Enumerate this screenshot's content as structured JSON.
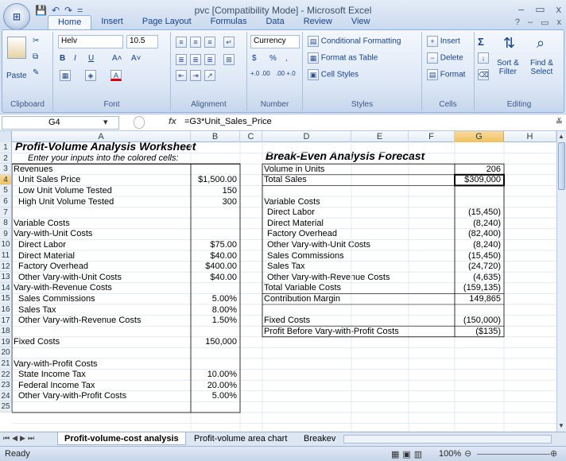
{
  "window": {
    "title": "pvc  [Compatibility Mode] - Microsoft Excel",
    "min": "–",
    "max": "▭",
    "close": "x"
  },
  "qat": {
    "save": "💾",
    "undo": "↶",
    "redo": "↷",
    "more": "="
  },
  "office_button": "⊞",
  "tabs": [
    "Home",
    "Insert",
    "Page Layout",
    "Formulas",
    "Data",
    "Review",
    "View"
  ],
  "active_tab": "Home",
  "ribbon": {
    "clipboard": {
      "label": "Clipboard",
      "paste": "Paste"
    },
    "font": {
      "label": "Font",
      "name": "Helv",
      "size": "10.5",
      "bold": "B",
      "italic": "I",
      "underline": "U",
      "grow": "A˄",
      "shrink": "A˅"
    },
    "alignment": {
      "label": "Alignment"
    },
    "number": {
      "label": "Number",
      "format": "Currency",
      "currency": "$",
      "percent": "%",
      "comma": ",",
      "inc": "+.0 .00",
      "dec": ".00 +.0"
    },
    "styles": {
      "label": "Styles",
      "cond": "Conditional Formatting",
      "table": "Format as Table",
      "cell": "Cell Styles"
    },
    "cells": {
      "label": "Cells",
      "insert": "Insert",
      "delete": "Delete",
      "format": "Format"
    },
    "editing": {
      "label": "Editing",
      "sum": "Σ",
      "sort": "Sort &",
      "sort2": "Filter",
      "find": "Find &",
      "find2": "Select"
    }
  },
  "formula_bar": {
    "name_box": "G4",
    "fx": "fx",
    "formula": "=G3*Unit_Sales_Price"
  },
  "columns": [
    "A",
    "B",
    "C",
    "D",
    "E",
    "F",
    "G",
    "H"
  ],
  "selected_column": "G",
  "selected_row": "4",
  "rows": [
    "1",
    "2",
    "3",
    "4",
    "5",
    "6",
    "7",
    "8",
    "9",
    "10",
    "11",
    "12",
    "13",
    "14",
    "15",
    "16",
    "17",
    "18",
    "19",
    "20",
    "21",
    "22",
    "23",
    "24",
    "25"
  ],
  "left_title": "Profit-Volume Analysis Worksheet",
  "left_subtitle": "Enter your inputs into the colored cells:",
  "left_items": [
    {
      "row": 3,
      "label": "Revenues",
      "indent": 0,
      "value": ""
    },
    {
      "row": 4,
      "label": "Unit Sales Price",
      "indent": 1,
      "value": "$1,500.00"
    },
    {
      "row": 5,
      "label": "Low Unit Volume Tested",
      "indent": 1,
      "value": "150"
    },
    {
      "row": 6,
      "label": "High Unit Volume Tested",
      "indent": 1,
      "value": "300"
    },
    {
      "row": 8,
      "label": "Variable Costs",
      "indent": 0,
      "value": ""
    },
    {
      "row": 9,
      "label": "Vary-with-Unit Costs",
      "indent": 0,
      "value": ""
    },
    {
      "row": 10,
      "label": "Direct Labor",
      "indent": 1,
      "value": "$75.00"
    },
    {
      "row": 11,
      "label": "Direct Material",
      "indent": 1,
      "value": "$40.00"
    },
    {
      "row": 12,
      "label": "Factory Overhead",
      "indent": 1,
      "value": "$400.00"
    },
    {
      "row": 13,
      "label": "Other Vary-with-Unit Costs",
      "indent": 1,
      "value": "$40.00"
    },
    {
      "row": 14,
      "label": "Vary-with-Revenue Costs",
      "indent": 0,
      "value": ""
    },
    {
      "row": 15,
      "label": "Sales Commissions",
      "indent": 1,
      "value": "5.00%"
    },
    {
      "row": 16,
      "label": "Sales Tax",
      "indent": 1,
      "value": "8.00%"
    },
    {
      "row": 17,
      "label": "Other Vary-with-Revenue Costs",
      "indent": 1,
      "value": "1.50%"
    },
    {
      "row": 19,
      "label": "Fixed Costs",
      "indent": 0,
      "value": "150,000"
    },
    {
      "row": 21,
      "label": "Vary-with-Profit Costs",
      "indent": 0,
      "value": ""
    },
    {
      "row": 22,
      "label": "State Income Tax",
      "indent": 1,
      "value": "10.00%"
    },
    {
      "row": 23,
      "label": "Federal Income Tax",
      "indent": 1,
      "value": "20.00%"
    },
    {
      "row": 24,
      "label": "Other Vary-with-Profit Costs",
      "indent": 1,
      "value": "5.00%"
    }
  ],
  "right_title": "Break-Even Analysis Forecast",
  "right_items": [
    {
      "row": 3,
      "label": "Volume in Units",
      "indent": 0,
      "value": "206"
    },
    {
      "row": 4,
      "label": "Total Sales",
      "indent": 0,
      "value": "$309,000"
    },
    {
      "row": 6,
      "label": "Variable Costs",
      "indent": 0,
      "value": ""
    },
    {
      "row": 7,
      "label": "Direct Labor",
      "indent": 1,
      "value": "(15,450)"
    },
    {
      "row": 8,
      "label": "Direct Material",
      "indent": 1,
      "value": "(8,240)"
    },
    {
      "row": 9,
      "label": "Factory Overhead",
      "indent": 1,
      "value": "(82,400)"
    },
    {
      "row": 10,
      "label": "Other Vary-with-Unit Costs",
      "indent": 1,
      "value": "(8,240)"
    },
    {
      "row": 11,
      "label": "Sales Commissions",
      "indent": 1,
      "value": "(15,450)"
    },
    {
      "row": 12,
      "label": "Sales Tax",
      "indent": 1,
      "value": "(24,720)"
    },
    {
      "row": 13,
      "label": "Other Vary-with-Revenue Costs",
      "indent": 1,
      "value": "(4,635)"
    },
    {
      "row": 14,
      "label": "Total Variable Costs",
      "indent": 0,
      "value": "(159,135)"
    },
    {
      "row": 15,
      "label": "Contribution Margin",
      "indent": 0,
      "value": "149,865"
    },
    {
      "row": 17,
      "label": "Fixed Costs",
      "indent": 0,
      "value": "(150,000)"
    },
    {
      "row": 18,
      "label": "Profit Before Vary-with-Profit Costs",
      "indent": 0,
      "value": "($135)"
    }
  ],
  "sheet_tabs": [
    "Profit-volume-cost analysis",
    "Profit-volume area chart",
    "Breakev"
  ],
  "status": {
    "ready": "Ready",
    "zoom": "100%"
  }
}
